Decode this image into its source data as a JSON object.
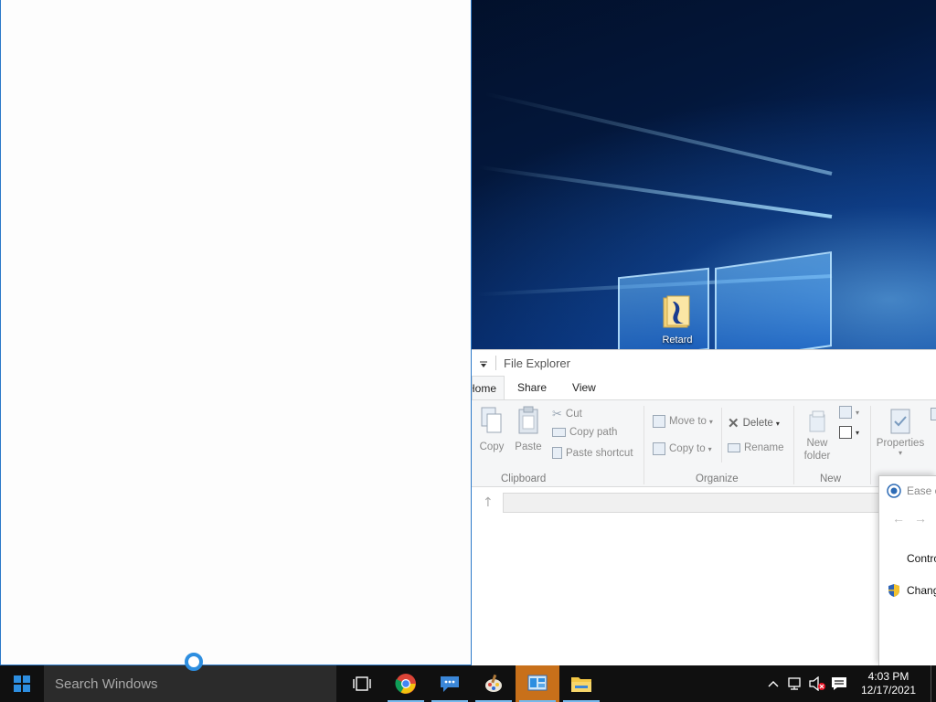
{
  "desktop": {
    "icons": [
      {
        "label": "Retard"
      }
    ]
  },
  "file_explorer": {
    "title": "File Explorer",
    "tabs": [
      {
        "label": "Home"
      },
      {
        "label": "Share"
      },
      {
        "label": "View"
      }
    ],
    "ribbon": {
      "clipboard": {
        "group_label": "Clipboard",
        "copy": "Copy",
        "paste": "Paste",
        "cut": "Cut",
        "copy_path": "Copy path",
        "paste_shortcut": "Paste shortcut"
      },
      "organize": {
        "group_label": "Organize",
        "move_to": "Move to",
        "copy_to": "Copy to",
        "delete": "Delete",
        "rename": "Rename"
      },
      "new": {
        "group_label": "New",
        "new_folder_line1": "New",
        "new_folder_line2": "folder"
      },
      "open": {
        "properties": "Properties"
      }
    }
  },
  "ease_window": {
    "title": "Ease of Access",
    "control_panel": "Control Panel",
    "change_link": "Change"
  },
  "taskbar": {
    "search_placeholder": "Search Windows",
    "apps": [
      {
        "name": "task-view"
      },
      {
        "name": "chrome"
      },
      {
        "name": "messaging"
      },
      {
        "name": "paint"
      },
      {
        "name": "control-panel",
        "active": true
      },
      {
        "name": "file-explorer"
      }
    ],
    "clock": {
      "time": "4:03 PM",
      "date": "12/17/2021"
    }
  },
  "colors": {
    "taskbar_bg": "#101010",
    "search_bg": "#2b2b2b",
    "active_app": "#c8701a",
    "accent": "#2d8ee0"
  }
}
